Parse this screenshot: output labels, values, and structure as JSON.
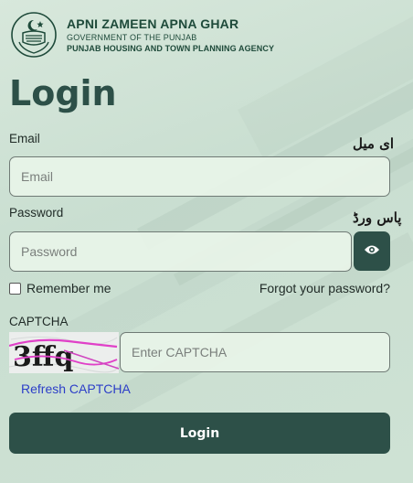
{
  "header": {
    "title": "APNI ZAMEEN APNA GHAR",
    "subtitle": "GOVERNMENT OF THE PUNJAB",
    "agency": "PUNJAB HOUSING AND TOWN PLANNING AGENCY",
    "logo_icon": "punjab-emblem-icon"
  },
  "page": {
    "heading": "Login"
  },
  "email": {
    "label": "Email",
    "label_urdu": "ای میل",
    "placeholder": "Email",
    "value": ""
  },
  "password": {
    "label": "Password",
    "label_urdu": "پاس ورڈ",
    "placeholder": "Password",
    "value": "",
    "toggle_icon": "eye-icon"
  },
  "remember": {
    "label": "Remember me",
    "checked": false
  },
  "forgot": {
    "label": "Forgot your password?"
  },
  "captcha": {
    "label": "CAPTCHA",
    "image_text": "3ffq",
    "placeholder": "Enter CAPTCHA",
    "value": "",
    "refresh_label": "Refresh CAPTCHA"
  },
  "login_button": {
    "label": "Login"
  },
  "colors": {
    "primary": "#2d5048",
    "link": "#2c3ec8",
    "header_text": "#1e4a3a"
  }
}
